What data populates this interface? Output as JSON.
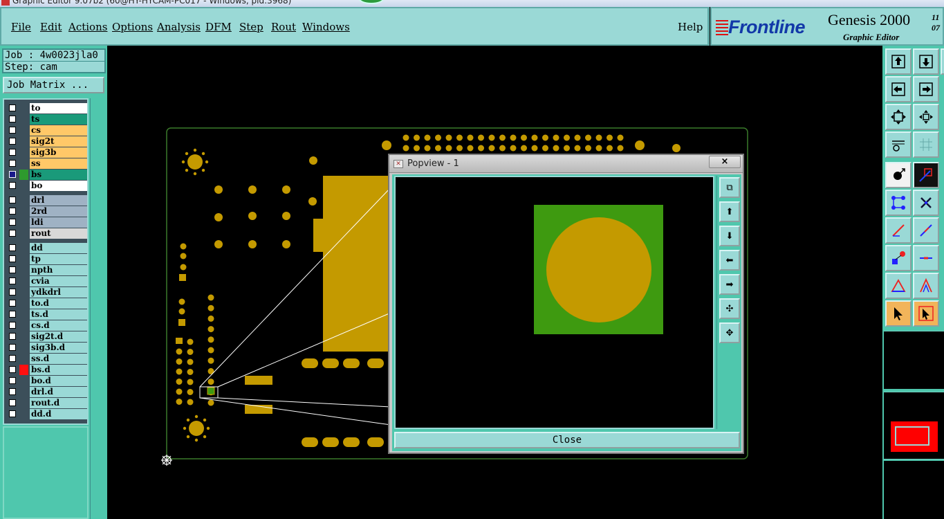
{
  "window": {
    "title": "Graphic Editor 9.07b2 (60@HY-HYCAM-PC017 - Windows, pid:3968)"
  },
  "menu": {
    "items": [
      {
        "label": "File"
      },
      {
        "label": "Edit"
      },
      {
        "label": "Actions"
      },
      {
        "label": "Options"
      },
      {
        "label": "Analysis"
      },
      {
        "label": "DFM"
      },
      {
        "label": "Step"
      },
      {
        "label": "Rout"
      },
      {
        "label": "Windows"
      }
    ],
    "help": "Help"
  },
  "brand": {
    "logo": "Frontline",
    "product": "Genesis 2000",
    "subtitle": "Graphic Editor",
    "version_top": "11",
    "version_bottom": "07"
  },
  "job": {
    "job_label": "Job : 4w0023jla0",
    "step_label": "Step: cam",
    "matrix_button": "Job Matrix ..."
  },
  "layers": {
    "board": [
      {
        "name": "to",
        "bg": "#ffffff"
      },
      {
        "name": "ts",
        "bg": "#1a9a7a"
      },
      {
        "name": "cs",
        "bg": "#ffc868"
      },
      {
        "name": "sig2t",
        "bg": "#ffc868"
      },
      {
        "name": "sig3b",
        "bg": "#ffc868"
      },
      {
        "name": "ss",
        "bg": "#ffc868"
      },
      {
        "name": "bs",
        "bg": "#1a9a7a",
        "selected": true,
        "swatch": "#2e9a2e"
      },
      {
        "name": "bo",
        "bg": "#ffffff"
      }
    ],
    "drill": [
      {
        "name": "drl",
        "bg": "#9fb2c4"
      },
      {
        "name": "2rd",
        "bg": "#9fb2c4"
      },
      {
        "name": "ldi",
        "bg": "#9fb2c4"
      },
      {
        "name": "rout",
        "bg": "#d8d8d8"
      }
    ],
    "misc": [
      {
        "name": "dd"
      },
      {
        "name": "tp"
      },
      {
        "name": "npth"
      },
      {
        "name": "cvia"
      },
      {
        "name": "ydkdrl"
      },
      {
        "name": "to.d"
      },
      {
        "name": "ts.d"
      },
      {
        "name": "cs.d"
      },
      {
        "name": "sig2t.d"
      },
      {
        "name": "sig3b.d"
      },
      {
        "name": "ss.d"
      },
      {
        "name": "bs.d",
        "swatch": "#ff1010"
      },
      {
        "name": "bo.d"
      },
      {
        "name": "drl.d"
      },
      {
        "name": "rout.d"
      },
      {
        "name": "dd.d"
      }
    ]
  },
  "popview": {
    "title": "Popview - 1",
    "close_x": "×",
    "close_button": "Close"
  },
  "colors": {
    "panel": "#9ad9d6",
    "panel_dark": "#4fc7ad",
    "copper": "#c49a00",
    "solder_mask": "#3e9a10",
    "board_outline": "#3a7a2a"
  }
}
